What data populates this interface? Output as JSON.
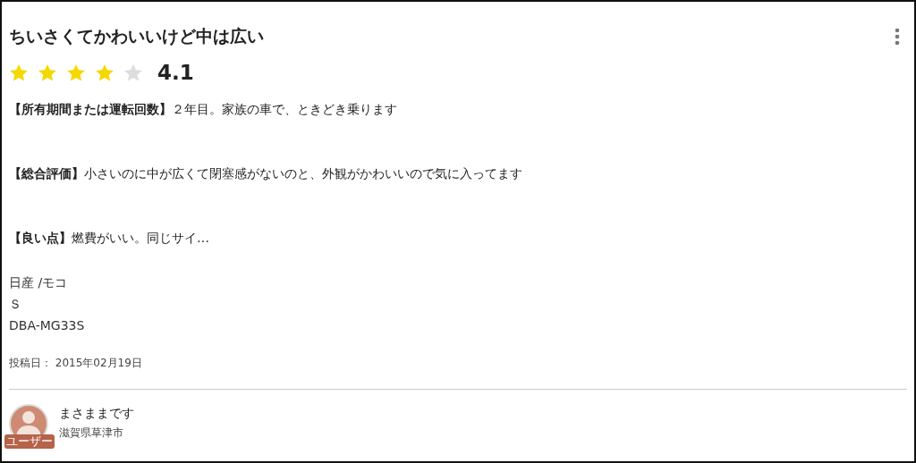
{
  "review": {
    "title": "ちいさくてかわいいけど中は広い",
    "stars": 4,
    "rating": "4.1",
    "sections": [
      {
        "label": "【所有期間または運転回数】",
        "text": "２年目。家族の車で、ときどき乗ります"
      },
      {
        "label": "【総合評価】",
        "text": "小さいのに中が広くて閉塞感がないのと、外観がかわいいので気に入ってます"
      },
      {
        "label": "【良い点】",
        "text": "燃費がいい。同じサイ…"
      }
    ],
    "car": [
      "日産 /モコ",
      "Ｓ",
      "DBA-MG33S"
    ],
    "posted": "投稿日： 2015年02月19日",
    "user": {
      "avatar_label": "ユーザー",
      "name": "まさままです",
      "location": "滋賀県草津市"
    }
  }
}
